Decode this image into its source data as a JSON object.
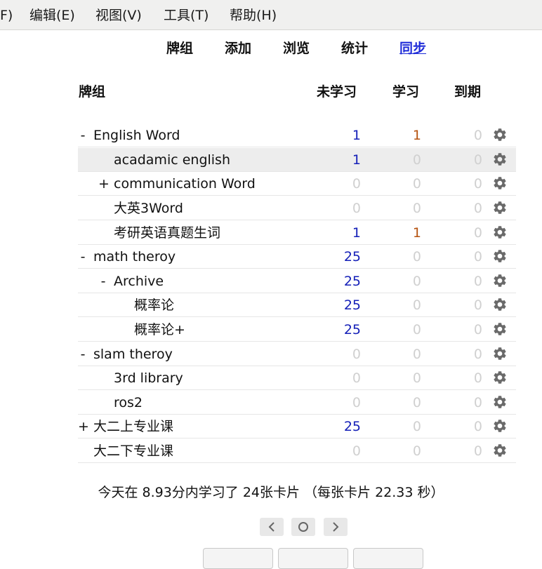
{
  "menu": {
    "items": [
      "F)",
      "编辑(E)",
      "视图(V)",
      "工具(T)",
      "帮助(H)"
    ]
  },
  "nav": {
    "decks": "牌组",
    "add": "添加",
    "browse": "浏览",
    "stats": "统计",
    "sync": "同步"
  },
  "table": {
    "headers": {
      "deck": "牌组",
      "new": "未学习",
      "learn": "学习",
      "due": "到期"
    },
    "rows": [
      {
        "expander": "-",
        "name": "English Word",
        "new": "1",
        "learn": "1",
        "due": "0"
      },
      {
        "expander": "",
        "name": "acadamic english",
        "new": "1",
        "learn": "0",
        "due": "0"
      },
      {
        "expander": "+",
        "name": "communication Word",
        "new": "0",
        "learn": "0",
        "due": "0"
      },
      {
        "expander": "",
        "name": "大英3Word",
        "new": "0",
        "learn": "0",
        "due": "0"
      },
      {
        "expander": "",
        "name": "考研英语真题生词",
        "new": "1",
        "learn": "1",
        "due": "0"
      },
      {
        "expander": "-",
        "name": "math theroy",
        "new": "25",
        "learn": "0",
        "due": "0"
      },
      {
        "expander": "-",
        "name": "Archive",
        "new": "25",
        "learn": "0",
        "due": "0"
      },
      {
        "expander": "",
        "name": "概率论",
        "new": "25",
        "learn": "0",
        "due": "0"
      },
      {
        "expander": "",
        "name": "概率论+",
        "new": "25",
        "learn": "0",
        "due": "0"
      },
      {
        "expander": "-",
        "name": "slam theroy",
        "new": "0",
        "learn": "0",
        "due": "0"
      },
      {
        "expander": "",
        "name": "3rd library",
        "new": "0",
        "learn": "0",
        "due": "0"
      },
      {
        "expander": "",
        "name": "ros2",
        "new": "0",
        "learn": "0",
        "due": "0"
      },
      {
        "expander": "+",
        "name": "大二上专业课",
        "new": "25",
        "learn": "0",
        "due": "0"
      },
      {
        "expander": "",
        "name": "大二下专业课",
        "new": "0",
        "learn": "0",
        "due": "0"
      }
    ]
  },
  "stats_text": "今天在 8.93分内学习了 24张卡片 （每张卡片 22.33 秒）",
  "icons": {
    "gear": "gear-icon",
    "prev": "chevron-left-icon",
    "circle": "circle-icon",
    "next": "chevron-right-icon"
  },
  "colors": {
    "new": "#1520b8",
    "learn": "#b5520f",
    "zero": "#d0d0d0",
    "link": "#1f2cd8"
  }
}
